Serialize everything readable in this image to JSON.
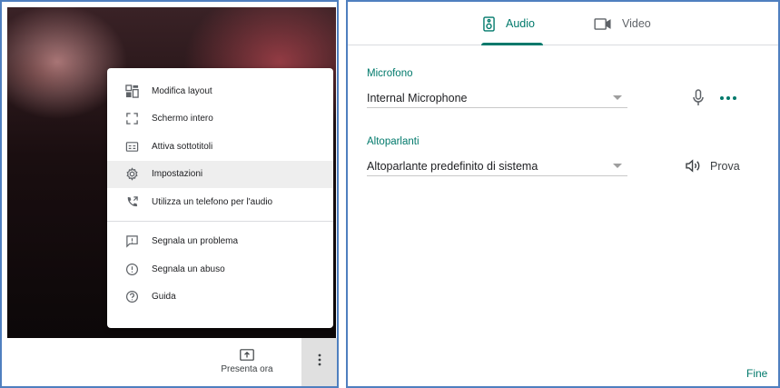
{
  "menu": {
    "items": [
      {
        "label": "Modifica layout",
        "icon": "layout-icon"
      },
      {
        "label": "Schermo intero",
        "icon": "fullscreen-icon"
      },
      {
        "label": "Attiva sottotitoli",
        "icon": "captions-icon"
      },
      {
        "label": "Impostazioni",
        "icon": "gear-icon"
      },
      {
        "label": "Utilizza un telefono per l'audio",
        "icon": "phone-icon"
      },
      {
        "label": "Segnala un problema",
        "icon": "report-problem-icon"
      },
      {
        "label": "Segnala un abuso",
        "icon": "alert-circle-icon"
      },
      {
        "label": "Guida",
        "icon": "help-icon"
      }
    ],
    "highlighted": "Impostazioni"
  },
  "bottom_bar": {
    "present_label": "Presenta ora"
  },
  "settings": {
    "tabs": [
      {
        "label": "Audio",
        "icon": "speaker-icon",
        "active": true
      },
      {
        "label": "Video",
        "icon": "videocam-icon",
        "active": false
      }
    ],
    "microphone": {
      "label": "Microfono",
      "value": "Internal Microphone"
    },
    "speakers": {
      "label": "Altoparlanti",
      "value": "Altoparlante predefinito di sistema",
      "test_label": "Prova"
    },
    "done_label": "Fine"
  },
  "colors": {
    "accent": "#00796b",
    "menu_highlight": "#eeeeee",
    "frame_border": "#4f7fbf"
  }
}
